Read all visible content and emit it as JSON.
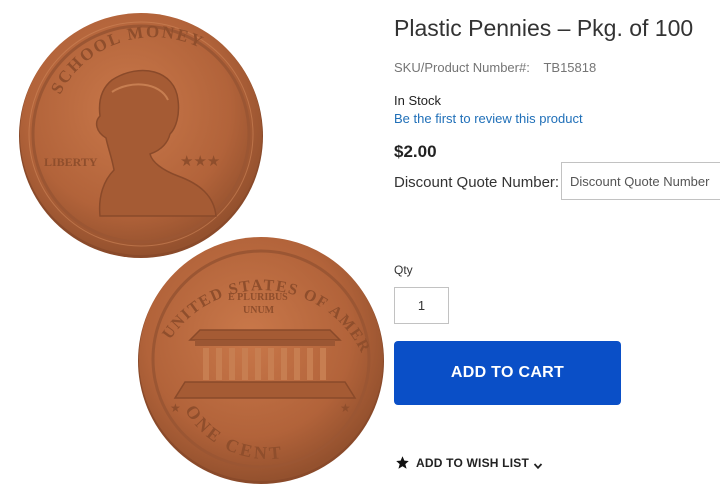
{
  "product": {
    "title": "Plastic Pennies – Pkg. of 100",
    "sku_label": "SKU/Product Number#:",
    "sku_value": "TB15818",
    "stock_status": "In Stock",
    "review_link": "Be the first to review this product",
    "price": "$2.00"
  },
  "quote": {
    "label": "Discount Quote Number:",
    "placeholder": "Discount Quote Number"
  },
  "quantity": {
    "label": "Qty",
    "value": "1"
  },
  "actions": {
    "add_to_cart": "ADD TO CART",
    "wishlist": "ADD TO WISH LIST"
  },
  "coins": {
    "front_top_text": "SCHOOL MONEY",
    "front_side_text": "LIBERTY",
    "back_top_text": "UNITED STATES OF AMERICA",
    "back_motto_line1": "E PLURIBUS",
    "back_motto_line2": "UNUM",
    "back_bottom_text": "ONE CENT"
  },
  "colors": {
    "accent_button": "#0a4fc7",
    "link": "#1f6fb8",
    "coin_base": "#b5663a"
  },
  "icons": {
    "wishlist_icon": "star-icon",
    "wishlist_dropdown": "chevron-down-icon"
  }
}
